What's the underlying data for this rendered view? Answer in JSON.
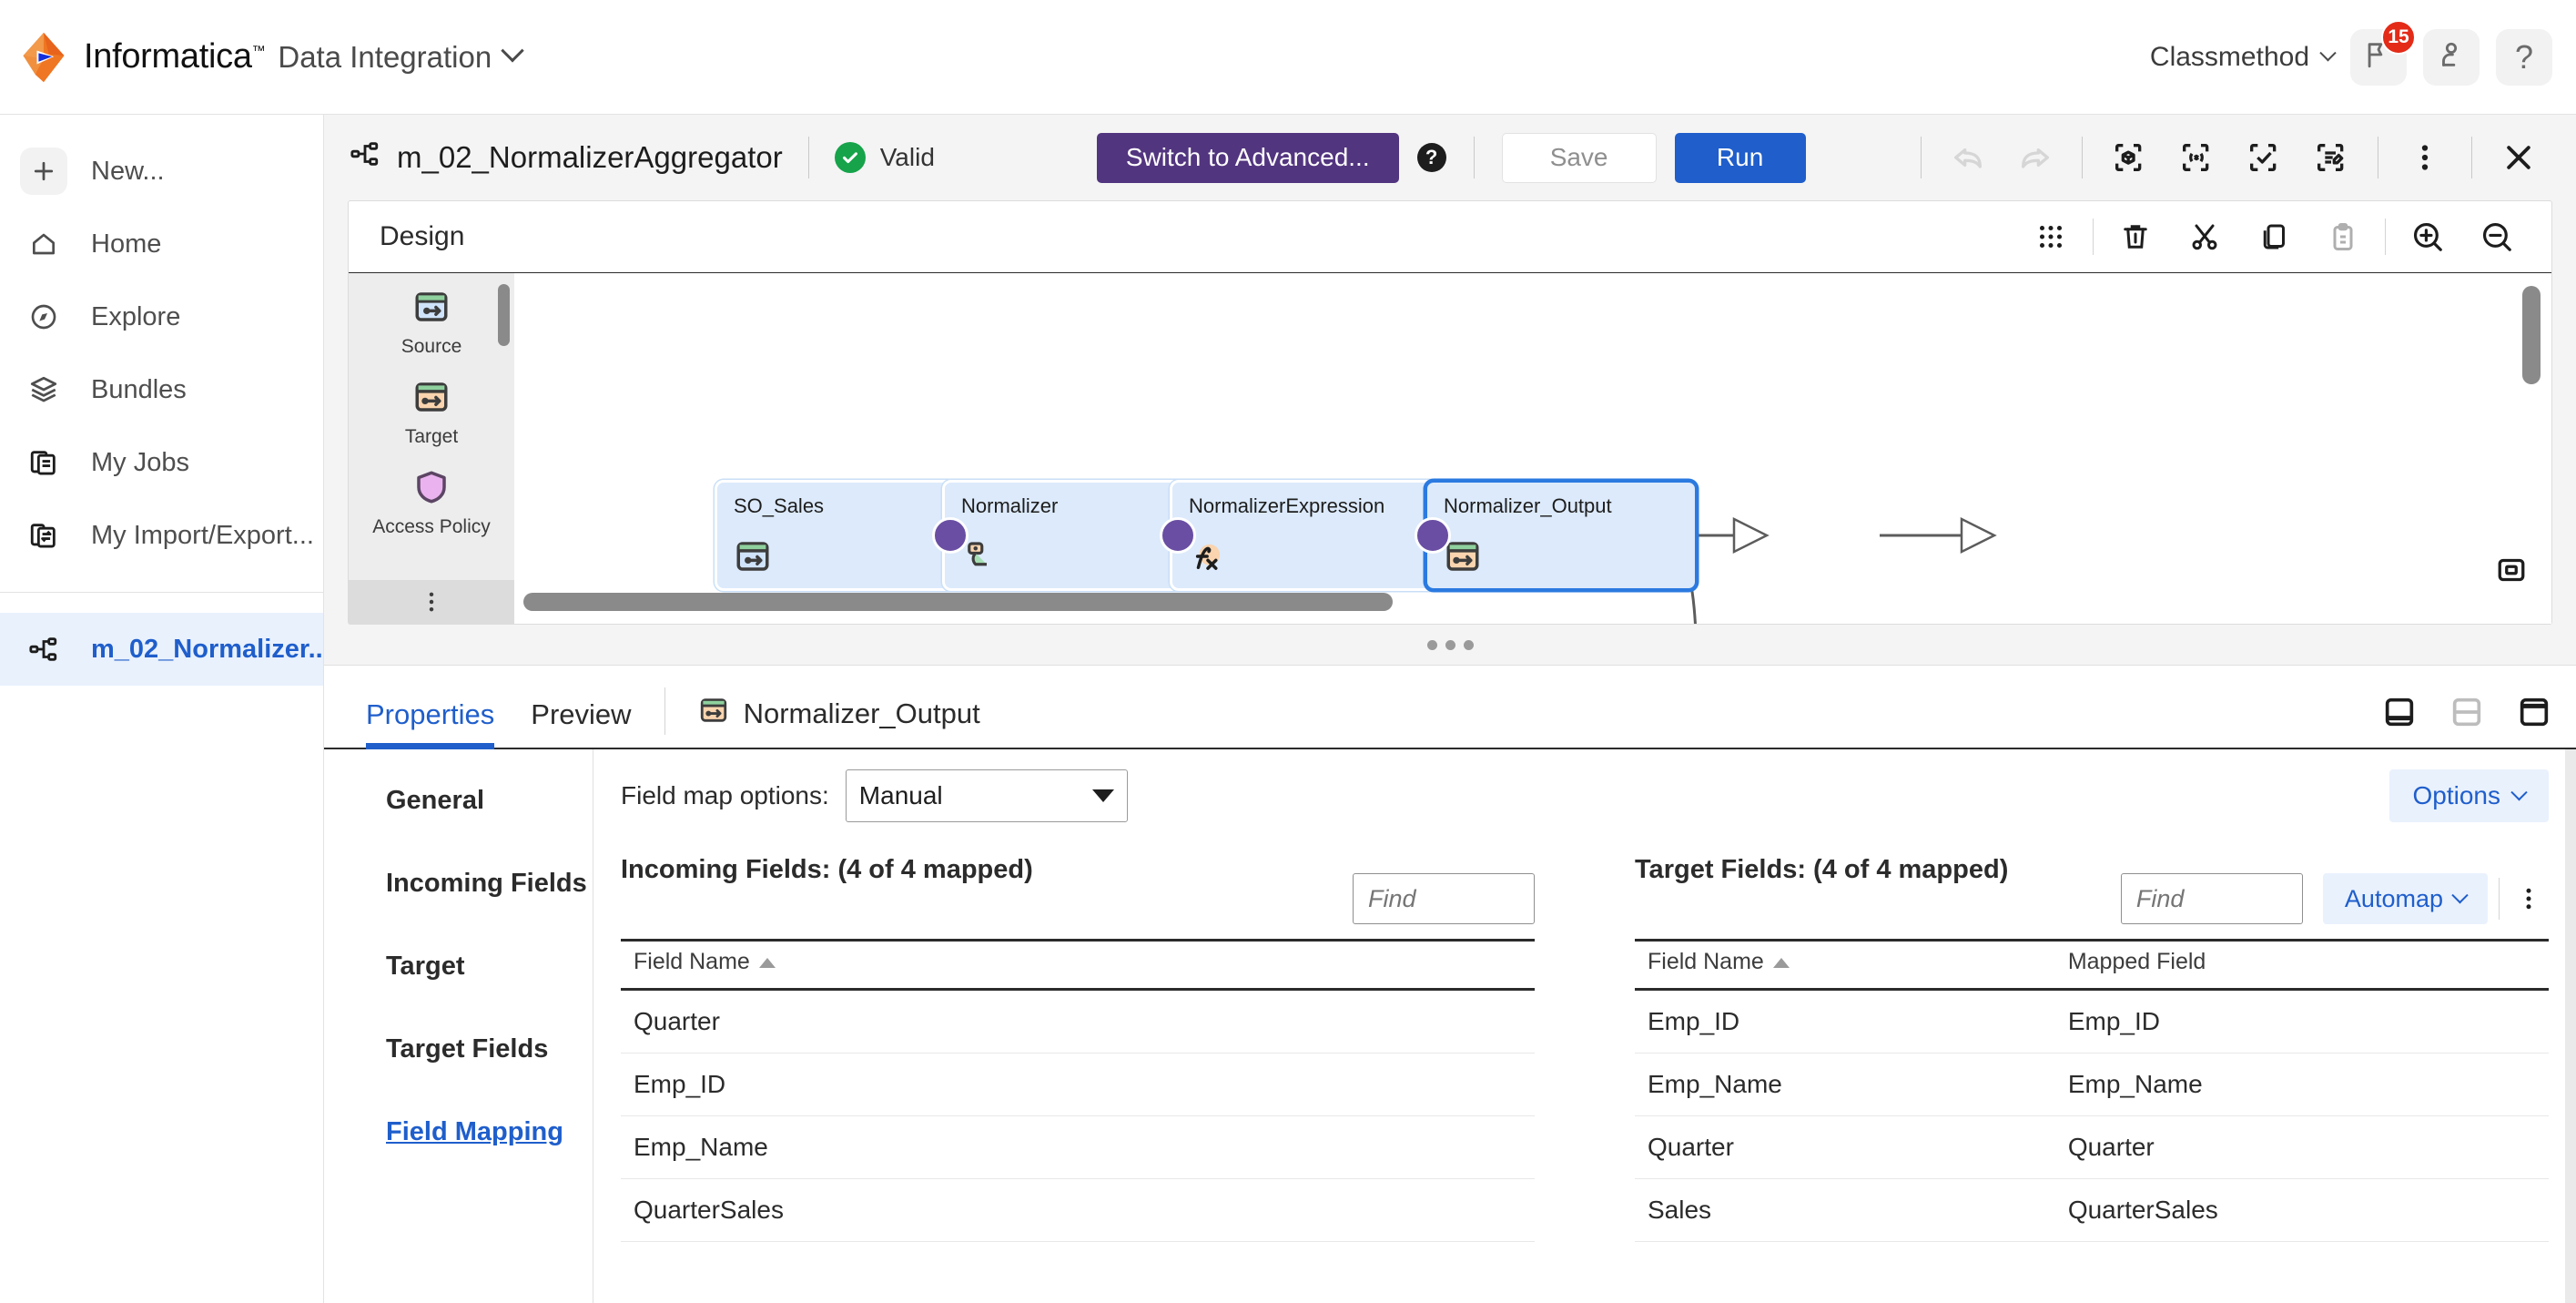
{
  "topbar": {
    "brand": "Informatica",
    "trademark": "™",
    "product": "Data Integration",
    "org": "Classmethod",
    "notifications_badge": "15",
    "help_glyph": "?"
  },
  "sidebar": {
    "items": [
      {
        "label": "New...",
        "icon": "plus-icon"
      },
      {
        "label": "Home",
        "icon": "home-icon"
      },
      {
        "label": "Explore",
        "icon": "compass-icon"
      },
      {
        "label": "Bundles",
        "icon": "layers-icon"
      },
      {
        "label": "My Jobs",
        "icon": "jobs-icon"
      },
      {
        "label": "My Import/Export...",
        "icon": "import-export-icon"
      }
    ],
    "open_asset": {
      "label": "m_02_Normalizer...",
      "icon": "mapping-icon"
    }
  },
  "actionbar": {
    "mapping_name": "m_02_NormalizerAggregator",
    "status": "Valid",
    "switch_advanced": "Switch to Advanced...",
    "help": "?",
    "save": "Save",
    "run": "Run"
  },
  "design": {
    "title": "Design",
    "palette": [
      {
        "label": "Source",
        "icon": "source-icon"
      },
      {
        "label": "Target",
        "icon": "target-icon"
      },
      {
        "label": "Access Policy",
        "icon": "shield-icon"
      }
    ],
    "nodes": [
      {
        "name": "SO_Sales",
        "icon": "source-icon",
        "selected": false
      },
      {
        "name": "Normalizer",
        "icon": "normalizer-icon",
        "selected": false
      },
      {
        "name": "NormalizerExpression",
        "icon": "expression-icon",
        "selected": false
      },
      {
        "name": "Normalizer_Output",
        "icon": "target-icon",
        "selected": true
      }
    ]
  },
  "properties": {
    "tabs": [
      {
        "label": "Properties",
        "active": true
      },
      {
        "label": "Preview",
        "active": false
      }
    ],
    "node_label": "Normalizer_Output",
    "nav": [
      {
        "label": "General",
        "active": false
      },
      {
        "label": "Incoming Fields",
        "active": false
      },
      {
        "label": "Target",
        "active": false
      },
      {
        "label": "Target Fields",
        "active": false
      },
      {
        "label": "Field Mapping",
        "active": true
      }
    ],
    "field_map_options_label": "Field map options:",
    "field_map_options_value": "Manual",
    "options_button": "Options",
    "incoming": {
      "title": "Incoming Fields: (4 of 4 mapped)",
      "find_placeholder": "Find",
      "columns": [
        "Field Name"
      ],
      "rows": [
        [
          "Quarter"
        ],
        [
          "Emp_ID"
        ],
        [
          "Emp_Name"
        ],
        [
          "QuarterSales"
        ]
      ]
    },
    "target": {
      "title": "Target Fields: (4 of 4 mapped)",
      "find_placeholder": "Find",
      "automap_button": "Automap",
      "columns": [
        "Field Name",
        "Mapped Field"
      ],
      "rows": [
        [
          "Emp_ID",
          "Emp_ID"
        ],
        [
          "Emp_Name",
          "Emp_Name"
        ],
        [
          "Quarter",
          "Quarter"
        ],
        [
          "Sales",
          "QuarterSales"
        ]
      ]
    }
  },
  "colors": {
    "accent_blue": "#1f5ecb",
    "advanced_purple": "#52357f",
    "valid_green": "#16a34a",
    "badge_red": "#e32b18",
    "node_fill": "#dceafb",
    "port_purple": "#6a4ea3"
  }
}
